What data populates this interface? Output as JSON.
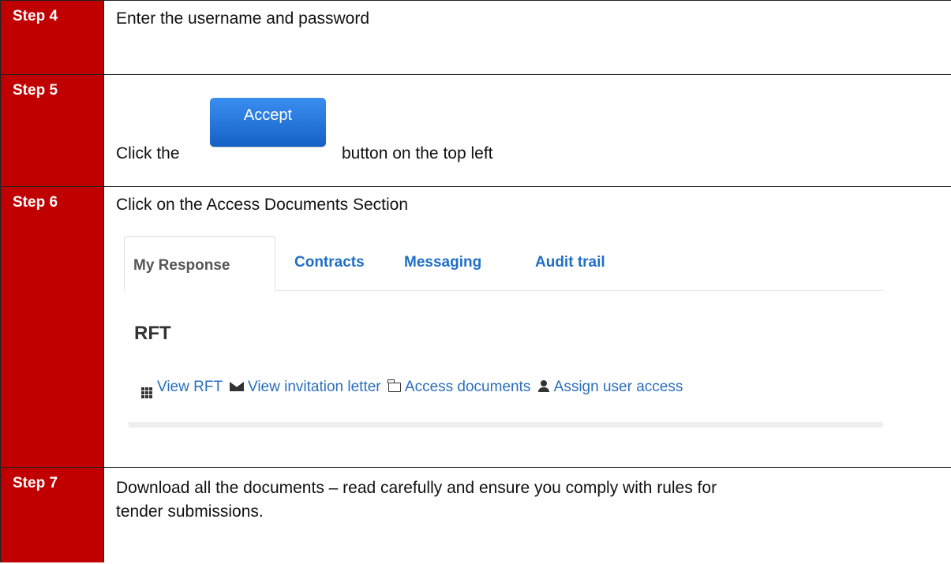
{
  "steps": [
    {
      "label": "Step 4",
      "text": "Enter the username and password"
    },
    {
      "label": "Step 5",
      "text_before": "Click the",
      "button_label": "Accept",
      "text_after": "button on the top left"
    },
    {
      "label": "Step 6",
      "text": "Click on the Access Documents Section",
      "tabs": [
        "My Response",
        "Contracts",
        "Messaging",
        "Audit trail"
      ],
      "section_title": "RFT",
      "actions": [
        "View RFT",
        "View invitation letter",
        "Access documents",
        "Assign user access"
      ]
    },
    {
      "label": "Step 7",
      "text_line1": "Download all the documents – read carefully and ensure you comply with rules for",
      "text_line2": "tender submissions."
    }
  ],
  "colors": {
    "step_bg": "#c00000",
    "accept_button": "#1f6fd6",
    "link": "#1f6fc7"
  }
}
